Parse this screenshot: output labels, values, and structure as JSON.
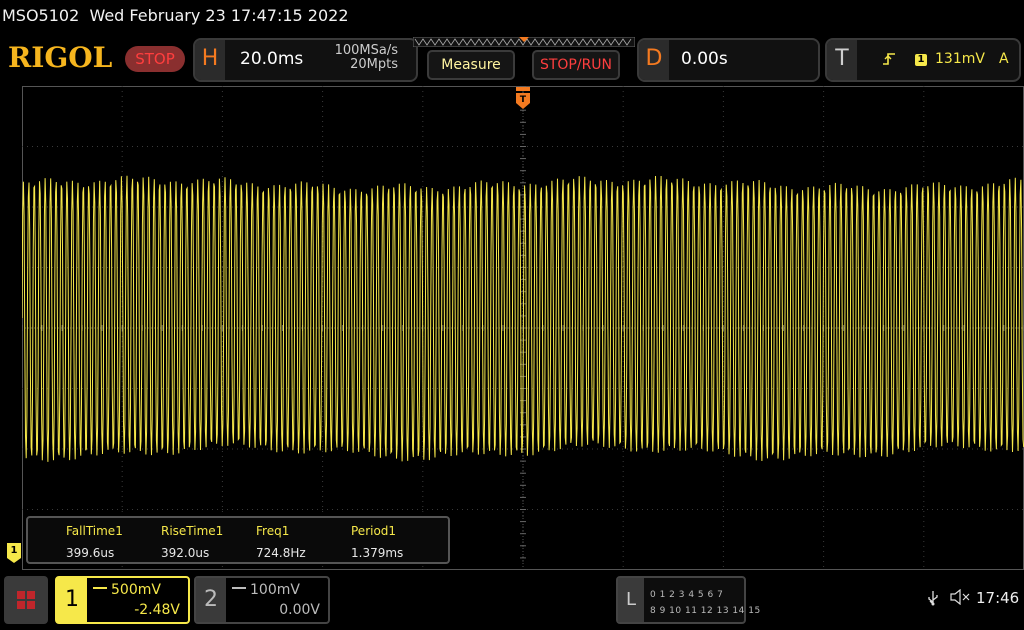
{
  "title_bar": {
    "model": "MSO5102",
    "datetime": "Wed February 23 17:47:15 2022"
  },
  "logo": "RIGOL",
  "run_state": "STOP",
  "horizontal": {
    "letter": "H",
    "timebase": "20.0ms",
    "sample_rate": "100MSa/s",
    "memory_depth": "20Mpts"
  },
  "buttons": {
    "measure": "Measure",
    "stop_run": "STOP/RUN"
  },
  "delay": {
    "letter": "D",
    "value": "0.00s"
  },
  "trigger": {
    "letter": "T",
    "edge_icon": "rising-edge-icon",
    "source": "1",
    "level": "131mV",
    "mode": "A"
  },
  "measurements": [
    {
      "label": "FallTime1",
      "value": "399.6us"
    },
    {
      "label": "RiseTime1",
      "value": "392.0us"
    },
    {
      "label": "Freq1",
      "value": "724.8Hz"
    },
    {
      "label": "Period1",
      "value": "1.379ms"
    }
  ],
  "channels": {
    "ch1": {
      "number": "1",
      "scale": "500mV",
      "offset": "-2.48V",
      "color": "#f6e84a",
      "ground_marker": "1"
    },
    "ch2": {
      "number": "2",
      "scale": "100mV",
      "offset": "0.00V",
      "color": "#9a9a9a"
    }
  },
  "logic_analyzer": {
    "letter": "L",
    "row1": "0 1 2 3  4 5 6 7",
    "row2": "8 9 10 11  12 13 14 15"
  },
  "status": {
    "clock": "17:46",
    "usb_icon": "usb-icon",
    "speaker_icon": "speaker-muted-icon"
  },
  "colors": {
    "trace": "#f6e84a",
    "accent_orange": "#f47a20",
    "stop_red": "#ff3e3e",
    "grid": "#3a3a3a"
  }
}
